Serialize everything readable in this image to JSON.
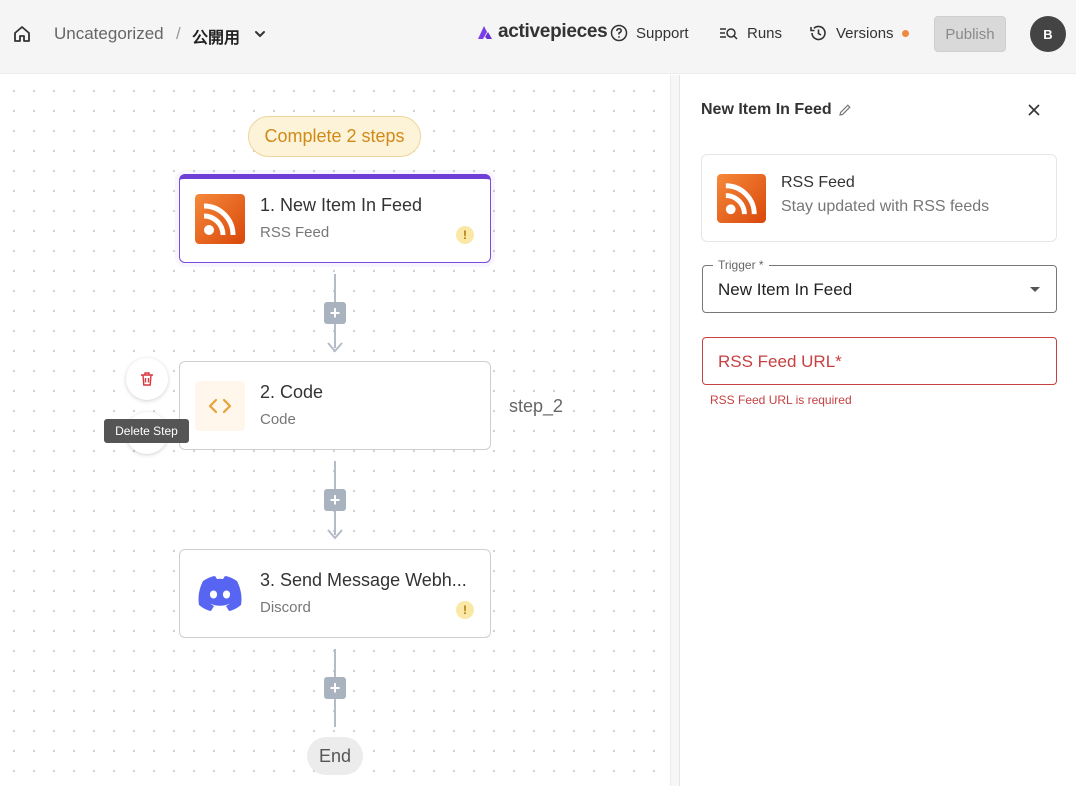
{
  "header": {
    "folder": "Uncategorized",
    "separator": "/",
    "flow_name": "公開用",
    "logo_text": "activepieces",
    "support_label": "Support",
    "runs_label": "Runs",
    "versions_label": "Versions",
    "publish_label": "Publish",
    "avatar_initial": "B",
    "brand_color": "#6e3fd6"
  },
  "canvas": {
    "complete_label": "Complete 2 steps",
    "steps": [
      {
        "title": "1. New Item In Feed",
        "subtitle": "RSS Feed",
        "icon": "rss-icon",
        "warning": "!"
      },
      {
        "title": "2. Code",
        "subtitle": "Code",
        "icon": "code-icon"
      },
      {
        "title": "3. Send Message Webh...",
        "subtitle": "Discord",
        "icon": "discord-icon",
        "warning": "!"
      }
    ],
    "step_label": "step_2",
    "end_label": "End",
    "delete_tooltip": "Delete Step"
  },
  "panel": {
    "title": "New Item In Feed",
    "piece_name": "RSS Feed",
    "piece_description": "Stay updated with RSS feeds",
    "trigger_label": "Trigger *",
    "trigger_value": "New Item In Feed",
    "url_placeholder": "RSS Feed URL*",
    "url_error": "RSS Feed URL is required"
  }
}
